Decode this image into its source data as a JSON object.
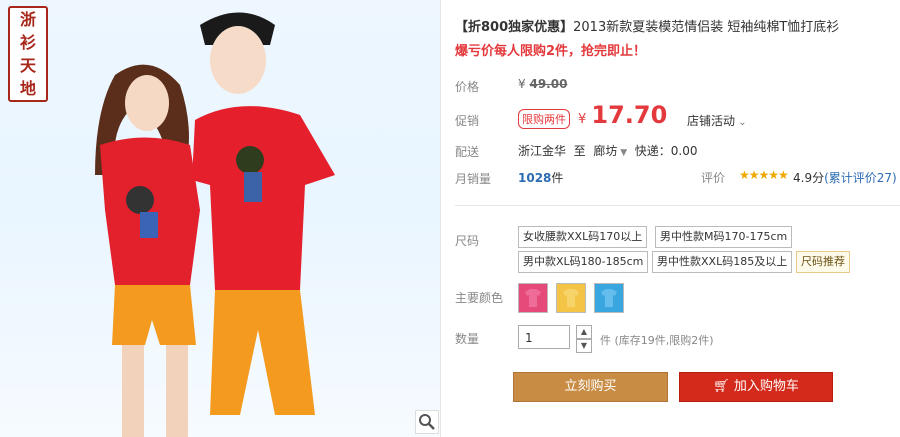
{
  "brand": [
    "浙",
    "衫",
    "天",
    "地"
  ],
  "title": {
    "bracket": "【折800独家优惠】",
    "text": "2013新款夏装模范情侣装 短袖纯棉T恤打底衫"
  },
  "promo": "爆亏价每人限购2件，抢完即止！",
  "labels": {
    "price": "价格",
    "promo_price": "促销",
    "shipping": "配送",
    "monthly_sales": "月销量",
    "rating": "评价",
    "size": "尺码",
    "color": "主要颜色",
    "quantity": "数量"
  },
  "price": {
    "original_currency": "¥",
    "original": "49.00",
    "badge": "限购两件",
    "currency": "¥",
    "current": "17.70",
    "activity": "店铺活动"
  },
  "shipping": {
    "from": "浙江金华",
    "to_word": "至",
    "to": "廊坊",
    "express": "快递：0.00"
  },
  "sales": {
    "count": "1028",
    "unit": "件"
  },
  "rating": {
    "stars": "★★★★★",
    "score": "4.9分",
    "link": "(累计评价27)"
  },
  "sizes": [
    "女收腰款XXL码170以上",
    "男中性款M码170-175cm",
    "男中款XL码180-185cm",
    "男中性款XXL码185及以上"
  ],
  "size_tip": "尺码推荐",
  "swatches": [
    {
      "color": "#e64a7a"
    },
    {
      "color": "#f3c445"
    },
    {
      "color": "#3aa6df"
    }
  ],
  "quantity": {
    "value": "1",
    "stock": "件 (库存19件,限购2件)"
  },
  "buttons": {
    "buy": "立刻购买",
    "cart": "加入购物车"
  }
}
